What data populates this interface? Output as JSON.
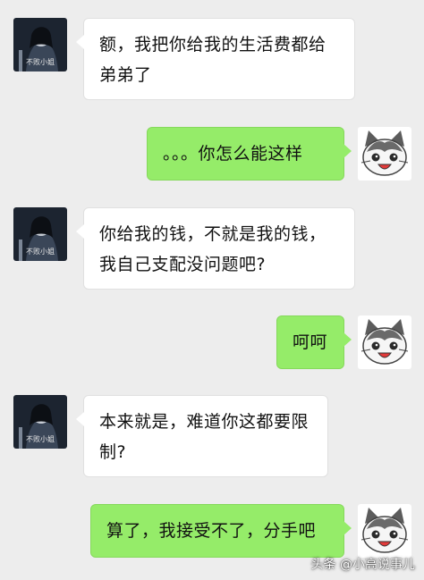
{
  "chat": {
    "messages": [
      {
        "side": "left",
        "avatar": "contact-avatar",
        "avatar_caption": "不败小姐",
        "text": "额，我把你给我的生活费都给弟弟了"
      },
      {
        "side": "right",
        "avatar": "cat-avatar",
        "text": "。。。你怎么能这样"
      },
      {
        "side": "left",
        "avatar": "contact-avatar",
        "avatar_caption": "不败小姐",
        "text": "你给我的钱，不就是我的钱，我自己支配没问题吧?"
      },
      {
        "side": "right",
        "avatar": "cat-avatar",
        "text": "呵呵"
      },
      {
        "side": "left",
        "avatar": "contact-avatar",
        "avatar_caption": "不败小姐",
        "text": "本来就是，难道你这都要限制?"
      },
      {
        "side": "right",
        "avatar": "cat-avatar",
        "text": "算了，我接受不了，分手吧"
      }
    ]
  },
  "watermark": "头条 @小高说事儿",
  "colors": {
    "background": "#ededed",
    "received_bubble": "#ffffff",
    "sent_bubble": "#95ec69"
  }
}
